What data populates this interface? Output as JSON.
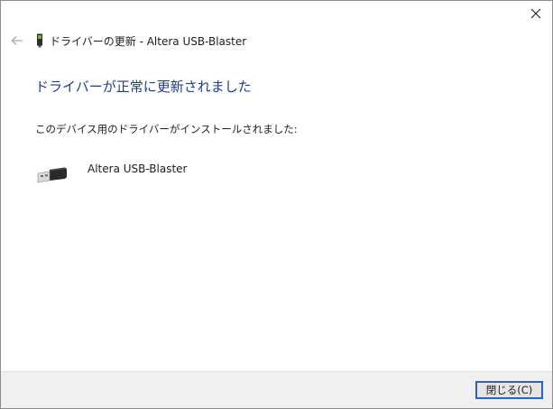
{
  "window": {
    "title": "ドライバーの更新 - Altera USB-Blaster",
    "close_icon": "close-icon",
    "back_icon": "back-arrow-icon"
  },
  "main": {
    "heading": "ドライバーが正常に更新されました",
    "description": "このデバイス用のドライバーがインストールされました:",
    "device": {
      "name": "Altera USB-Blaster",
      "icon": "usb-connector-icon"
    }
  },
  "footer": {
    "close_button_label": "閉じる(C)"
  },
  "colors": {
    "heading": "#1f3f8a",
    "footer_bg": "#f0f0f0",
    "button_border": "#2b64b6"
  }
}
